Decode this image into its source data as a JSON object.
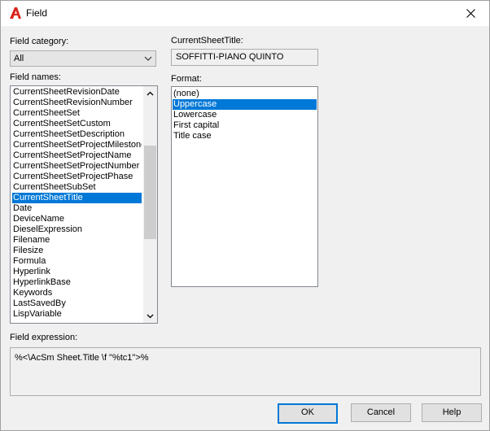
{
  "window": {
    "title": "Field",
    "close_label": "Close"
  },
  "labels": {
    "field_category": "Field category:",
    "field_names": "Field names:",
    "current_field": "CurrentSheetTitle:",
    "format": "Format:",
    "field_expression": "Field expression:"
  },
  "field_category": {
    "selected": "All"
  },
  "field_names": {
    "items": [
      "CurrentSheetRevisionDate",
      "CurrentSheetRevisionNumber",
      "CurrentSheetSet",
      "CurrentSheetSetCustom",
      "CurrentSheetSetDescription",
      "CurrentSheetSetProjectMilestone",
      "CurrentSheetSetProjectName",
      "CurrentSheetSetProjectNumber",
      "CurrentSheetSetProjectPhase",
      "CurrentSheetSubSet",
      "CurrentSheetTitle",
      "Date",
      "DeviceName",
      "DieselExpression",
      "Filename",
      "Filesize",
      "Formula",
      "Hyperlink",
      "HyperlinkBase",
      "Keywords",
      "LastSavedBy",
      "LispVariable"
    ],
    "selected_index": 10
  },
  "current_value": "SOFFITTI-PIANO QUINTO",
  "format": {
    "items": [
      "(none)",
      "Uppercase",
      "Lowercase",
      "First capital",
      "Title case"
    ],
    "selected_index": 1
  },
  "field_expression": "%<\\AcSm Sheet.Title \\f \"%tc1\">%",
  "buttons": {
    "ok": "OK",
    "cancel": "Cancel",
    "help": "Help"
  },
  "colors": {
    "selection": "#0078d7",
    "brand_icon": "#d9261c"
  }
}
